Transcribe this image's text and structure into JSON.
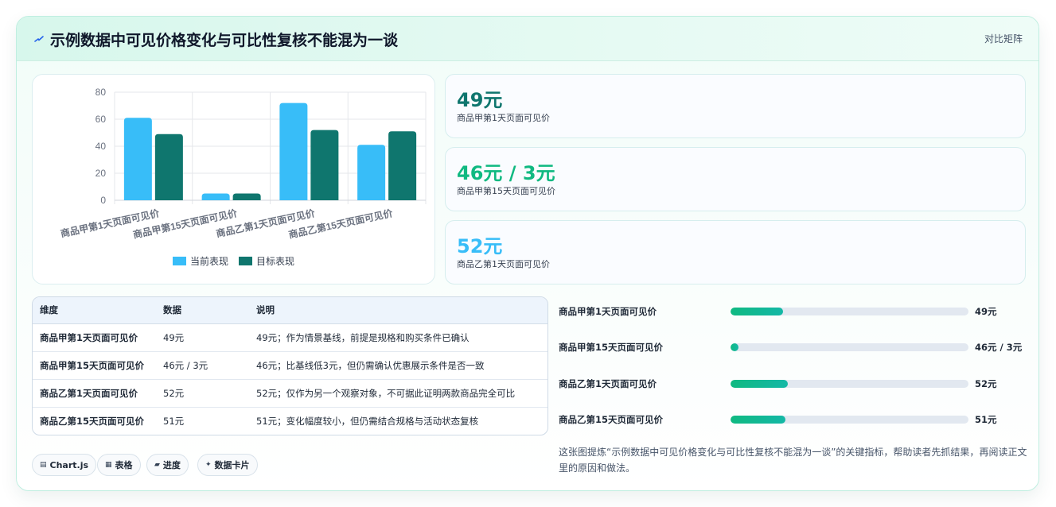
{
  "header": {
    "title": "示例数据中可见价格变化与可比性复核不能混为一谈",
    "tag": "对比矩阵"
  },
  "chart_data": {
    "type": "bar",
    "categories": [
      "商品甲第1天页面可见价",
      "商品甲第15天页面可见价",
      "商品乙第1天页面可见价",
      "商品乙第15天页面可见价"
    ],
    "series": [
      {
        "name": "当前表现",
        "values": [
          61,
          5,
          72,
          41
        ],
        "color": "#38bdf8"
      },
      {
        "name": "目标表现",
        "values": [
          49,
          5,
          52,
          51
        ],
        "color": "#0f766e"
      }
    ],
    "ylim": [
      0,
      80
    ],
    "yticks": [
      0,
      20,
      40,
      60,
      80
    ],
    "legend_position": "bottom",
    "grid": true
  },
  "stats": [
    {
      "value": "49元",
      "label": "商品甲第1天页面可见价",
      "color": "#0f766e"
    },
    {
      "value": "46元 / 3元",
      "label": "商品甲第15天页面可见价",
      "color": "#10b981"
    },
    {
      "value": "52元",
      "label": "商品乙第1天页面可见价",
      "color": "#38bdf8"
    }
  ],
  "table": {
    "headers": [
      "维度",
      "数据",
      "说明"
    ],
    "rows": [
      [
        "商品甲第1天页面可见价",
        "49元",
        "49元；作为情景基线，前提是规格和购买条件已确认"
      ],
      [
        "商品甲第15天页面可见价",
        "46元 / 3元",
        "46元；比基线低3元，但仍需确认优惠展示条件是否一致"
      ],
      [
        "商品乙第1天页面可见价",
        "52元",
        "52元；仅作为另一个观察对象，不可据此证明两款商品完全可比"
      ],
      [
        "商品乙第15天页面可见价",
        "51元",
        "51元；变化幅度较小，但仍需结合规格与活动状态复核"
      ]
    ]
  },
  "progress": [
    {
      "label": "商品甲第1天页面可见价",
      "value": "49元",
      "fraction": 0.22
    },
    {
      "label": "商品甲第15天页面可见价",
      "value": "46元 / 3元",
      "fraction": 0.035
    },
    {
      "label": "商品乙第1天页面可见价",
      "value": "52元",
      "fraction": 0.24
    },
    {
      "label": "商品乙第15天页面可见价",
      "value": "51元",
      "fraction": 0.23
    }
  ],
  "note": "这张图提炼“示例数据中可见价格变化与可比性复核不能混为一谈”的关键指标，帮助读者先抓结果，再阅读正文里的原因和做法。",
  "pills": [
    {
      "icon": "▤",
      "icon_name": "chart-icon",
      "label": "Chart.js"
    },
    {
      "icon": "▦",
      "icon_name": "table-icon",
      "label": "表格"
    },
    {
      "icon": "▰",
      "icon_name": "progress-icon",
      "label": "进度"
    },
    {
      "icon": "✦",
      "icon_name": "sparkle-icon",
      "label": "数据卡片"
    }
  ]
}
